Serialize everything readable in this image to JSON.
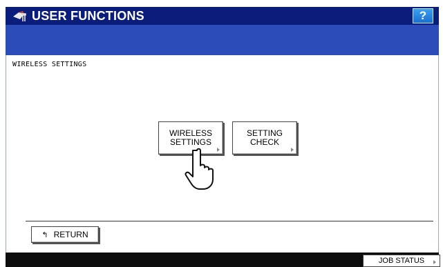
{
  "header": {
    "title": "USER FUNCTIONS",
    "help_label": "?"
  },
  "content": {
    "heading": "WIRELESS SETTINGS",
    "buttons": [
      {
        "label": "WIRELESS\nSETTINGS"
      },
      {
        "label": "SETTING\nCHECK"
      }
    ],
    "return_label": "RETURN",
    "return_icon": "↰"
  },
  "footer": {
    "job_status_label": "JOB STATUS"
  },
  "colors": {
    "titlebar": "#0b1d7a",
    "strip": "#2c4db9",
    "help": "#1a6fd0",
    "footer": "#0d0d0d"
  }
}
